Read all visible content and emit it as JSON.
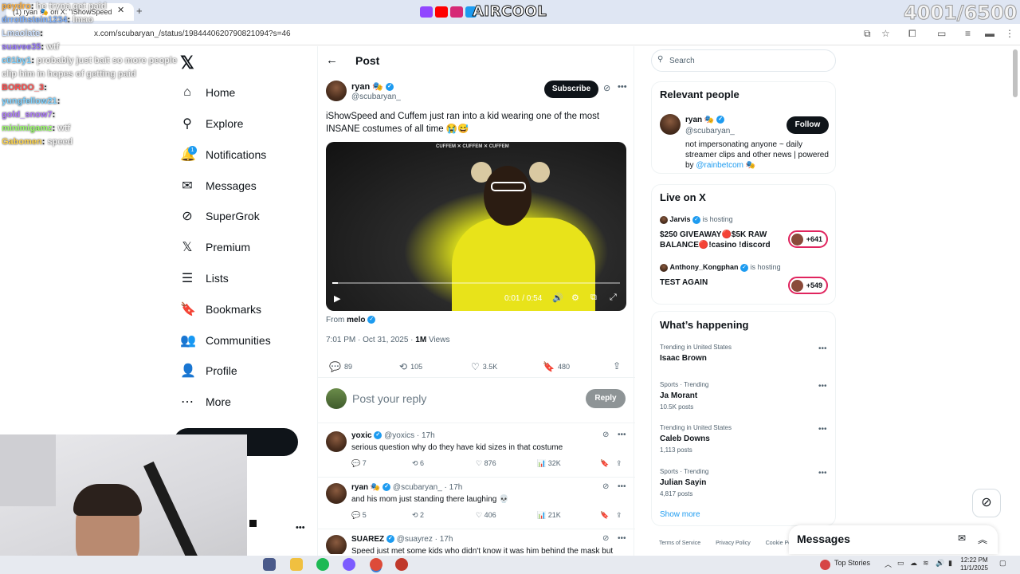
{
  "browser": {
    "tab_title": "(1) ryan 🎭 on X: \"iShowSpeed",
    "url": "x.com/scubaryan_/status/1984440620790821094?s=46"
  },
  "overlay": {
    "brand": "AIRCOOL",
    "counter": "4001/6500",
    "chat": [
      {
        "user": "peydro",
        "text": "he tryna get paid",
        "color": "#ffb347"
      },
      {
        "user": "drrothstein1234",
        "text": "lmao",
        "color": "#7fb2ff"
      },
      {
        "user": "Lmaolate",
        "text": "",
        "color": "#cfe3ff"
      },
      {
        "user": "suavee35",
        "text": "wtf",
        "color": "#9b7bff"
      },
      {
        "user": "c01by1",
        "text": "probably just bait so more people clip him in hopes of getting paid",
        "color": "#7fd2ff"
      },
      {
        "user": "BORDO_3",
        "text": "",
        "color": "#ff4d4d"
      },
      {
        "user": "yungfellow21",
        "text": "",
        "color": "#7fd2ff"
      },
      {
        "user": "gold_snow7",
        "text": "",
        "color": "#b07bff"
      },
      {
        "user": "minimigamz",
        "text": "wtf",
        "color": "#9bff6b"
      },
      {
        "user": "Gabomen",
        "text": "speed",
        "color": "#ffd54d"
      }
    ]
  },
  "nav": {
    "items": [
      {
        "label": "Home",
        "icon": "home-icon",
        "glyph": "⌂"
      },
      {
        "label": "Explore",
        "icon": "search-icon",
        "glyph": "⚲"
      },
      {
        "label": "Notifications",
        "icon": "bell-icon",
        "glyph": "🔔"
      },
      {
        "label": "Messages",
        "icon": "mail-icon",
        "glyph": "✉"
      },
      {
        "label": "SuperGrok",
        "icon": "grok-icon",
        "glyph": "⊘"
      },
      {
        "label": "Premium",
        "icon": "x-icon",
        "glyph": "𝕏"
      },
      {
        "label": "Lists",
        "icon": "list-icon",
        "glyph": "☰"
      },
      {
        "label": "Bookmarks",
        "icon": "bookmark-icon",
        "glyph": "🔖"
      },
      {
        "label": "Communities",
        "icon": "people-icon",
        "glyph": "👥"
      },
      {
        "label": "Profile",
        "icon": "person-icon",
        "glyph": "👤"
      },
      {
        "label": "More",
        "icon": "more-circle-icon",
        "glyph": "⋯"
      }
    ],
    "notification_count": "1"
  },
  "post": {
    "header": "Post",
    "author_name": "ryan 🎭",
    "author_handle": "@scubaryan_",
    "subscribe_label": "Subscribe",
    "text": "iShowSpeed and Cuffem just ran into a kid wearing one of the most INSANE costumes of all time 😭😅",
    "video_overlay_text": "CUFFEM ✕ CUFFEM ✕ CUFFEM",
    "video_time": "0:01 / 0:54",
    "video_progress": 0.02,
    "from_label": "From",
    "from_name": "melo",
    "date": "7:01 PM · Oct 31, 2025 ·",
    "views_count": "1M",
    "views_label": "Views",
    "stats": {
      "replies": "89",
      "reposts": "105",
      "likes": "3.5K",
      "bookmarks": "480"
    },
    "reply_placeholder": "Post your reply",
    "reply_button": "Reply"
  },
  "replies": [
    {
      "name": "yoxic",
      "handle": "@yoxics · 17h",
      "text": "serious question why do they have kid sizes in that costume",
      "replies": "7",
      "reposts": "6",
      "likes": "876",
      "views": "32K"
    },
    {
      "name": "ryan 🎭",
      "handle": "@scubaryan_ · 17h",
      "text": "and his mom just standing there laughing 💀",
      "replies": "5",
      "reposts": "2",
      "likes": "406",
      "views": "21K"
    },
    {
      "name": "SUAREZ",
      "handle": "@suayrez · 17h",
      "text": "Speed just met some kids who didn't know it was him behind the mask but",
      "replies": "",
      "reposts": "",
      "likes": "",
      "views": ""
    }
  ],
  "sidebar": {
    "search_placeholder": "Search",
    "relevant_title": "Relevant people",
    "relevant": {
      "name": "ryan 🎭",
      "handle": "@scubaryan_",
      "follow": "Follow",
      "bio_text": "not impersonating anyone ~ daily streamer clips and other news | powered by ",
      "bio_link": "@rainbetcom",
      "bio_end": " 🎭"
    },
    "live_title": "Live on X",
    "live": [
      {
        "host": "Jarvis",
        "status": "is hosting",
        "title": "$250 GIVEAWAY🔴$5K RAW BALANCE🔴!casino !discord",
        "count": "+641"
      },
      {
        "host": "Anthony_Kongphan",
        "status": "is hosting",
        "title": "TEST AGAIN",
        "count": "+549"
      }
    ],
    "happening_title": "What’s happening",
    "trends": [
      {
        "meta": "Trending in United States",
        "name": "Isaac Brown",
        "posts": ""
      },
      {
        "meta": "Sports · Trending",
        "name": "Ja Morant",
        "posts": "10.5K posts"
      },
      {
        "meta": "Trending in United States",
        "name": "Caleb Downs",
        "posts": "1,113 posts"
      },
      {
        "meta": "Sports · Trending",
        "name": "Julian Sayin",
        "posts": "4,817 posts"
      }
    ],
    "show_more": "Show more",
    "footer": [
      "Terms of Service",
      "Privacy Policy",
      "Cookie Po"
    ]
  },
  "messages_dock": {
    "title": "Messages"
  },
  "taskbar": {
    "stories": "Top Stories",
    "time": "12:22 PM",
    "date": "11/1/2025"
  },
  "colors": {
    "accent": "#1d9bf0",
    "live": "#e0245e",
    "dark": "#0f1419"
  }
}
